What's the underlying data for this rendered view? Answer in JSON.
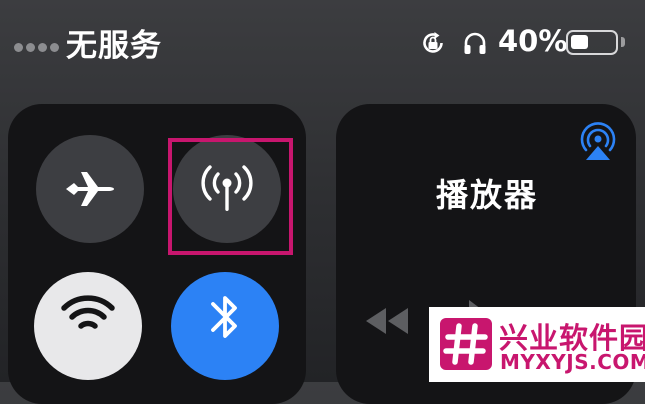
{
  "status_bar": {
    "carrier_text": "无服务",
    "battery_percent_text": "40%",
    "battery_level": 0.4,
    "icons": [
      "signal-dots-icon",
      "rotation-lock-icon",
      "headphones-icon",
      "battery-icon"
    ]
  },
  "connectivity": {
    "toggles": [
      {
        "name": "airplane-mode",
        "icon": "airplane-icon",
        "state": "off"
      },
      {
        "name": "cellular-data",
        "icon": "antenna-icon",
        "state": "off",
        "highlighted": true
      },
      {
        "name": "wifi",
        "icon": "wifi-icon",
        "state": "on"
      },
      {
        "name": "bluetooth",
        "icon": "bluetooth-icon",
        "state": "on"
      }
    ],
    "highlight_color": "#c8166e",
    "bluetooth_color": "#2c82f5"
  },
  "media": {
    "title": "播放器",
    "icons": [
      "airplay-icon",
      "rewind-icon",
      "play-icon"
    ],
    "airplay_color": "#2c82f5"
  },
  "watermark": {
    "title": "兴业软件园",
    "url": "MYXYJS.COM",
    "color": "#c8166e"
  }
}
